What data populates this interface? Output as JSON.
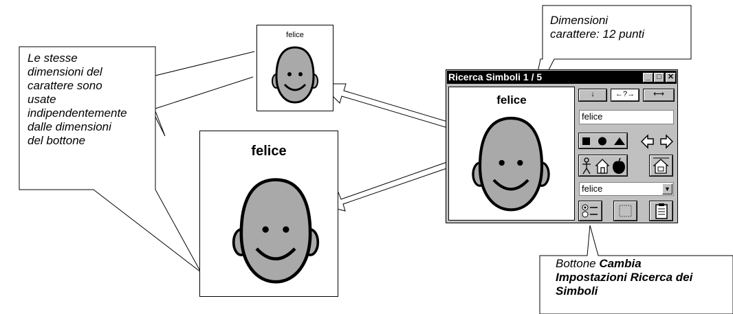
{
  "callouts": {
    "left_note": [
      "Le stesse",
      "dimensioni del",
      "carattere sono",
      "usate",
      "indipendentemente",
      "dalle dimensioni",
      "del bottone"
    ],
    "font_size_note": [
      "Dimensioni",
      "carattere: 12 punti"
    ],
    "button_note_prefix": "Bottone ",
    "button_note_bold": [
      "Cambia",
      "Impostazioni Ricerca dei",
      "Simboli"
    ]
  },
  "examples": {
    "small_label": "felice",
    "large_label": "felice"
  },
  "window": {
    "title": "Ricerca Simboli  1 / 5",
    "controls": {
      "minimize": "_",
      "maximize": "□",
      "close": "✕"
    },
    "preview_label": "felice",
    "layout_buttons": [
      "↓",
      "←?→",
      "⟷"
    ],
    "search_value": "felice",
    "shape_icons": [
      "square-icon",
      "circle-icon",
      "triangle-icon"
    ],
    "nav_icons": [
      "arrow-left-icon",
      "arrow-right-icon"
    ],
    "category_icons": [
      "person-icon",
      "house-icon",
      "apple-icon",
      "home-action-icon"
    ],
    "dropdown_value": "felice",
    "bottom_icons": [
      "settings-options-icon",
      "empty-frame-icon",
      "clipboard-icon"
    ]
  },
  "colors": {
    "titlebar": "#000000",
    "window_face": "#c0c0c0",
    "face_fill": "#a9a9a9"
  }
}
